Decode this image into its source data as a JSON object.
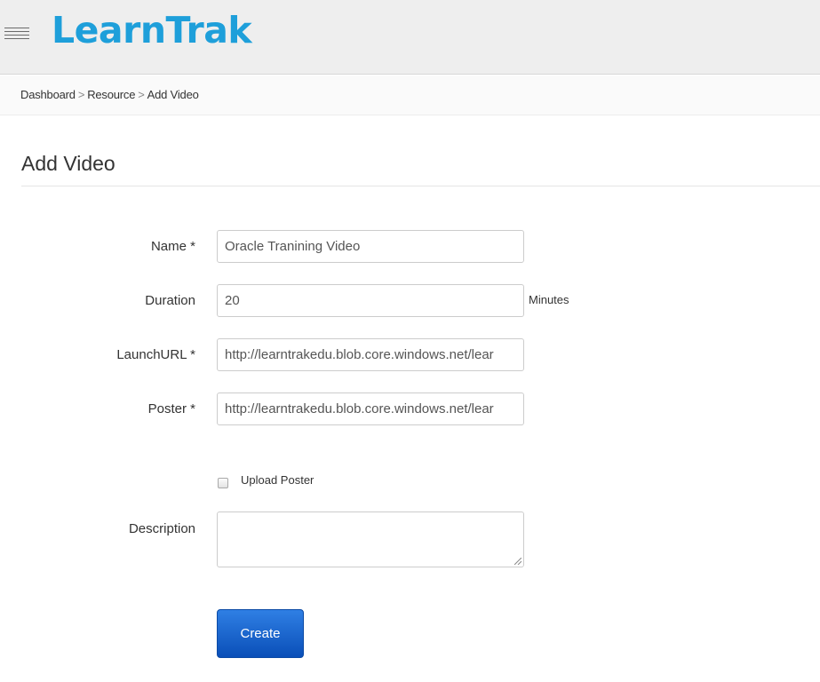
{
  "header": {
    "menu_icon": "hamburger-menu-icon",
    "logo_text": "LearnTrak",
    "logo_color": "#1e9fda"
  },
  "breadcrumb": {
    "items": [
      "Dashboard",
      "Resource",
      "Add Video"
    ],
    "separator": ">"
  },
  "page": {
    "title": "Add Video"
  },
  "form": {
    "name": {
      "label": "Name *",
      "value": "Oracle Tranining Video"
    },
    "duration": {
      "label": "Duration",
      "value": "20",
      "unit": "Minutes"
    },
    "launch_url": {
      "label": "LaunchURL *",
      "value": "http://learntrakedu.blob.core.windows.net/lear"
    },
    "poster": {
      "label": "Poster *",
      "value": "http://learntrakedu.blob.core.windows.net/lear"
    },
    "upload_poster": {
      "label": "Upload Poster",
      "checked": false
    },
    "description": {
      "label": "Description",
      "value": ""
    },
    "submit_label": "Create",
    "button_color_top": "#2f7fe4",
    "button_color_bottom": "#0a4fb8"
  }
}
